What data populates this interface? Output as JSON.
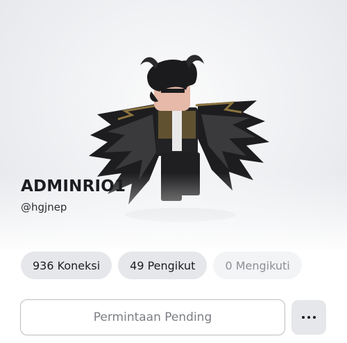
{
  "profile": {
    "display_name": "ADMINRIO1",
    "username": "@hgjnep"
  },
  "stats": [
    {
      "label": "936 Koneksi",
      "enabled": true
    },
    {
      "label": "49 Pengikut",
      "enabled": true
    },
    {
      "label": "0 Mengikuti",
      "enabled": false
    }
  ],
  "actions": {
    "primary_label": "Permintaan Pending",
    "more_icon": "ellipsis-horizontal-icon"
  },
  "colors": {
    "text_primary": "#1c1d20",
    "pill_background": "#e6e7ea",
    "disabled_text": "#8c8f95",
    "button_border": "#b9bcc2"
  }
}
